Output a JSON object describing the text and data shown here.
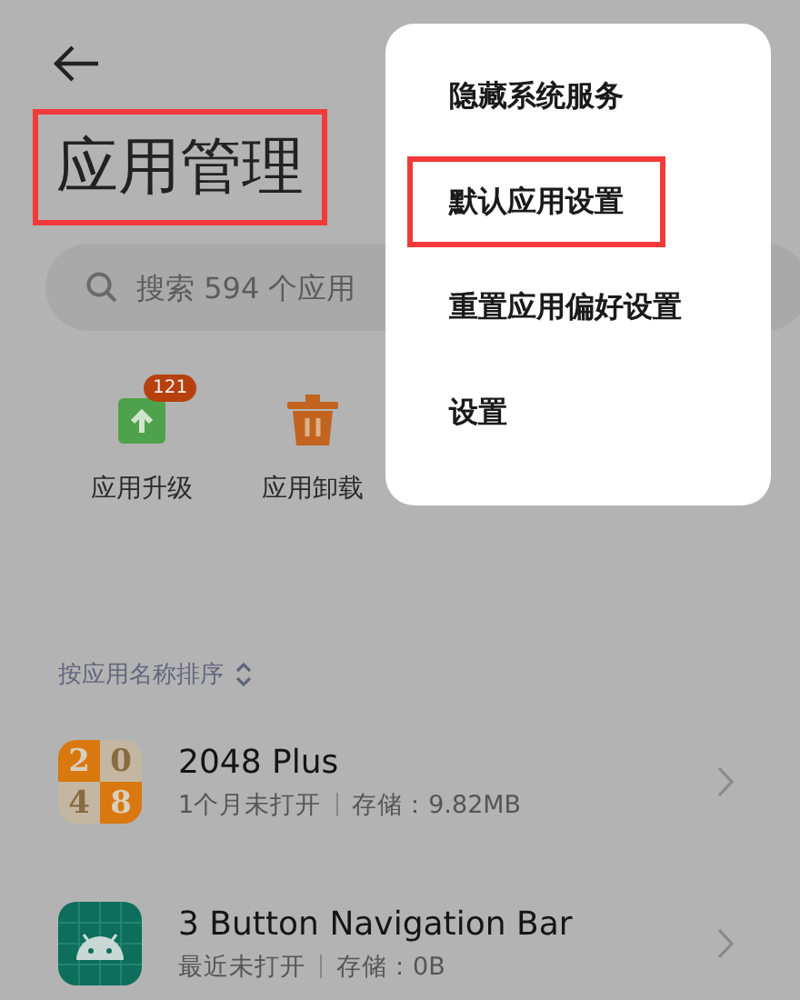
{
  "title": {
    "text": "应用管理",
    "highlighted": true
  },
  "search": {
    "placeholder": "搜索 594 个应用"
  },
  "shortcuts": [
    {
      "label": "应用升级",
      "kind": "upgrade",
      "badge": "121"
    },
    {
      "label": "应用卸载",
      "kind": "uninstall"
    }
  ],
  "sort": {
    "label": "按应用名称排序"
  },
  "apps": [
    {
      "name": "2048 Plus",
      "kind": "tiles",
      "tiles": [
        "2",
        "0",
        "4",
        "8"
      ],
      "last_opened": "1个月未打开",
      "storage": "存储：9.82MB"
    },
    {
      "name": "3 Button Navigation Bar",
      "kind": "android",
      "last_opened": "最近未打开",
      "storage": "存储：0B"
    }
  ],
  "menu": [
    {
      "label": "隐藏系统服务",
      "highlighted": false
    },
    {
      "label": "默认应用设置",
      "highlighted": true
    },
    {
      "label": "重置应用偏好设置",
      "highlighted": false
    },
    {
      "label": "设置",
      "highlighted": false
    }
  ]
}
